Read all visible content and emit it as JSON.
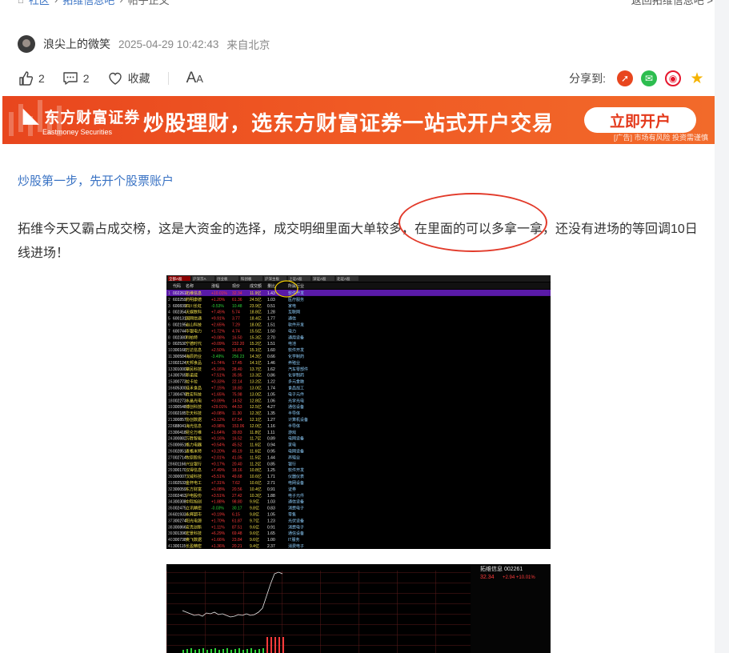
{
  "breadcrumb": {
    "home": "社区",
    "board": "拓维信息吧",
    "current": "帖子正文",
    "back": "返回拓维信息吧 >"
  },
  "author": {
    "name": "浪尖上的微笑",
    "time": "2025-04-29 10:42:43",
    "from": "来自北京"
  },
  "actions": {
    "like_count": "2",
    "comment_count": "2",
    "favorite_label": "收藏",
    "font_label": "AA"
  },
  "share": {
    "label": "分享到:"
  },
  "banner": {
    "brand_cn": "东方财富证券",
    "brand_en": "Eastmoney Securities",
    "slogan": "炒股理财，选东方财富证券一站式开户交易",
    "cta": "立即开户",
    "adtag": "[广告] 市场有风险 投资需谨慎"
  },
  "link_text": "炒股第一步，先开个股票账户",
  "paragraph": "拓维今天又霸占成交榜，这是大资金的选择，成交明细里面大单较多，在里面的可以多拿一拿，还没有进场的等回调10日线进场！",
  "colors": {
    "accent_link": "#3a73c4",
    "banner_orange": "#ef5423",
    "circle_red": "#e23a2a"
  },
  "screenshot1": {
    "title": "拓维信息",
    "tabs": [
      "全部A股",
      "沪深京A",
      "创业板",
      "科创板",
      "沪深主板",
      "上证A股",
      "深证A股",
      "北证A股"
    ],
    "headers": [
      "代码",
      "名称",
      "涨幅",
      "现价",
      "成交额",
      "量比",
      "所属行业"
    ],
    "rows": [
      [
        "002261",
        "拓维信息",
        "+10.01%",
        "32.34",
        "11.9亿",
        "1.43",
        "软件开发"
      ],
      [
        "603259",
        "药明康德",
        "+1.20%",
        "61.36",
        "24.5亿",
        "1.03",
        "医疗服务"
      ],
      [
        "600839",
        "四川长虹",
        "-0.53%",
        "10.48",
        "23.9亿",
        "0.51",
        "家电"
      ],
      [
        "002354",
        "天娱数科",
        "+7.45%",
        "5.74",
        "18.8亿",
        "1.28",
        "互联网"
      ],
      [
        "600131",
        "国网信通",
        "+9.91%",
        "3.77",
        "18.4亿",
        "1.77",
        "通信"
      ],
      [
        "002195",
        "岩山科技",
        "+2.65%",
        "7.29",
        "18.0亿",
        "1.51",
        "软件开发"
      ],
      [
        "600744",
        "华银电力",
        "+1.72%",
        "4.74",
        "15.5亿",
        "1.50",
        "电力"
      ],
      [
        "002380",
        "利柏特",
        "+0.08%",
        "16.50",
        "15.3亿",
        "2.70",
        "通用设备"
      ],
      [
        "002530",
        "宁德时代",
        "+0.09%",
        "232.20",
        "15.2亿",
        "1.51",
        "电池"
      ],
      [
        "300168",
        "万达信息",
        "+2.50%",
        "16.83",
        "15.1亿",
        "1.60",
        "软件开发"
      ],
      [
        "300584",
        "海辰药业",
        "-3.49%",
        "256.23",
        "14.3亿",
        "0.66",
        "化学制药"
      ],
      [
        "002124",
        "天邦食品",
        "+1.74%",
        "17.45",
        "14.1亿",
        "1.46",
        "养殖业"
      ],
      [
        "301000",
        "肇民科技",
        "+5.16%",
        "28.40",
        "13.7亿",
        "1.62",
        "汽车零部件"
      ],
      [
        "300765",
        "新诺威",
        "+7.51%",
        "35.95",
        "13.3亿",
        "0.86",
        "化学制药"
      ],
      [
        "300773",
        "拉卡拉",
        "+0.33%",
        "22.14",
        "13.2亿",
        "1.22",
        "多元金融"
      ],
      [
        "605300",
        "佳禾食品",
        "+7.15%",
        "18.80",
        "13.0亿",
        "1.74",
        "食品加工"
      ],
      [
        "300476",
        "胜宏科技",
        "+1.65%",
        "75.98",
        "13.0亿",
        "1.05",
        "电子元件"
      ],
      [
        "002273",
        "水晶光电",
        "+0.09%",
        "14.52",
        "12.8亿",
        "1.06",
        "光学光电"
      ],
      [
        "300548",
        "博创科技",
        "+29.01%",
        "44.53",
        "12.5亿",
        "4.27",
        "通信设备"
      ],
      [
        "002185",
        "华天科技",
        "+0.08%",
        "11.30",
        "12.3亿",
        "1.35",
        "半导体"
      ],
      [
        "300857",
        "协创数据",
        "+3.12%",
        "67.54",
        "12.1亿",
        "1.27",
        "计算机设备"
      ],
      [
        "688041",
        "海光信息",
        "+0.98%",
        "153.06",
        "12.0亿",
        "1.16",
        "半导体"
      ],
      [
        "300418",
        "昆仑万维",
        "+1.64%",
        "39.83",
        "11.8亿",
        "1.11",
        "游戏"
      ],
      [
        "300882",
        "万胜智能",
        "+0.16%",
        "16.52",
        "11.7亿",
        "0.89",
        "电网设备"
      ],
      [
        "000651",
        "格力电器",
        "+0.54%",
        "45.52",
        "11.6亿",
        "0.94",
        "家电"
      ],
      [
        "002851",
        "麦格米特",
        "+3.20%",
        "45.19",
        "11.6亿",
        "0.95",
        "电网设备"
      ],
      [
        "002714",
        "牧原股份",
        "+2.01%",
        "41.05",
        "11.5亿",
        "1.44",
        "养殖业"
      ],
      [
        "601166",
        "兴业银行",
        "+0.17%",
        "20.40",
        "11.2亿",
        "0.85",
        "银行"
      ],
      [
        "300170",
        "汉得信息",
        "+7.49%",
        "18.16",
        "10.8亿",
        "1.25",
        "软件开发"
      ],
      [
        "300007",
        "汉威科技",
        "+5.51%",
        "49.68",
        "10.6亿",
        "1.71",
        "仪器仪表"
      ],
      [
        "002533",
        "金杯电工",
        "+7.31%",
        "7.62",
        "10.6亿",
        "2.71",
        "电网设备"
      ],
      [
        "300059",
        "东方财富",
        "+0.08%",
        "20.56",
        "10.4亿",
        "0.91",
        "证券"
      ],
      [
        "002463",
        "沪电股份",
        "+3.51%",
        "27.42",
        "10.3亿",
        "1.88",
        "电子元件"
      ],
      [
        "300308",
        "中际旭创",
        "+1.88%",
        "98.80",
        "9.9亿",
        "1.03",
        "通信设备"
      ],
      [
        "002475",
        "立讯精密",
        "-0.03%",
        "30.17",
        "9.8亿",
        "0.83",
        "消费电子"
      ],
      [
        "601933",
        "永辉超市",
        "+0.19%",
        "6.15",
        "9.8亿",
        "1.05",
        "零售"
      ],
      [
        "300274",
        "阳光电源",
        "+1.70%",
        "61.87",
        "9.7亿",
        "1.23",
        "光伏设备"
      ],
      [
        "300866",
        "安克创新",
        "+1.11%",
        "87.51",
        "9.6亿",
        "0.91",
        "消费电子"
      ],
      [
        "301396",
        "宏景科技",
        "+6.29%",
        "69.48",
        "9.6亿",
        "1.65",
        "通信设备"
      ],
      [
        "300738",
        "奥飞数据",
        "+1.66%",
        "23.84",
        "9.6亿",
        "1.00",
        "IT服务"
      ],
      [
        "300115",
        "长盈精密",
        "+1.36%",
        "20.21",
        "9.4亿",
        "2.37",
        "消费电子"
      ]
    ]
  },
  "screenshot2": {
    "title": "拓维信息 002261",
    "price": "32.34",
    "change": "+2.94 +10.01%"
  }
}
